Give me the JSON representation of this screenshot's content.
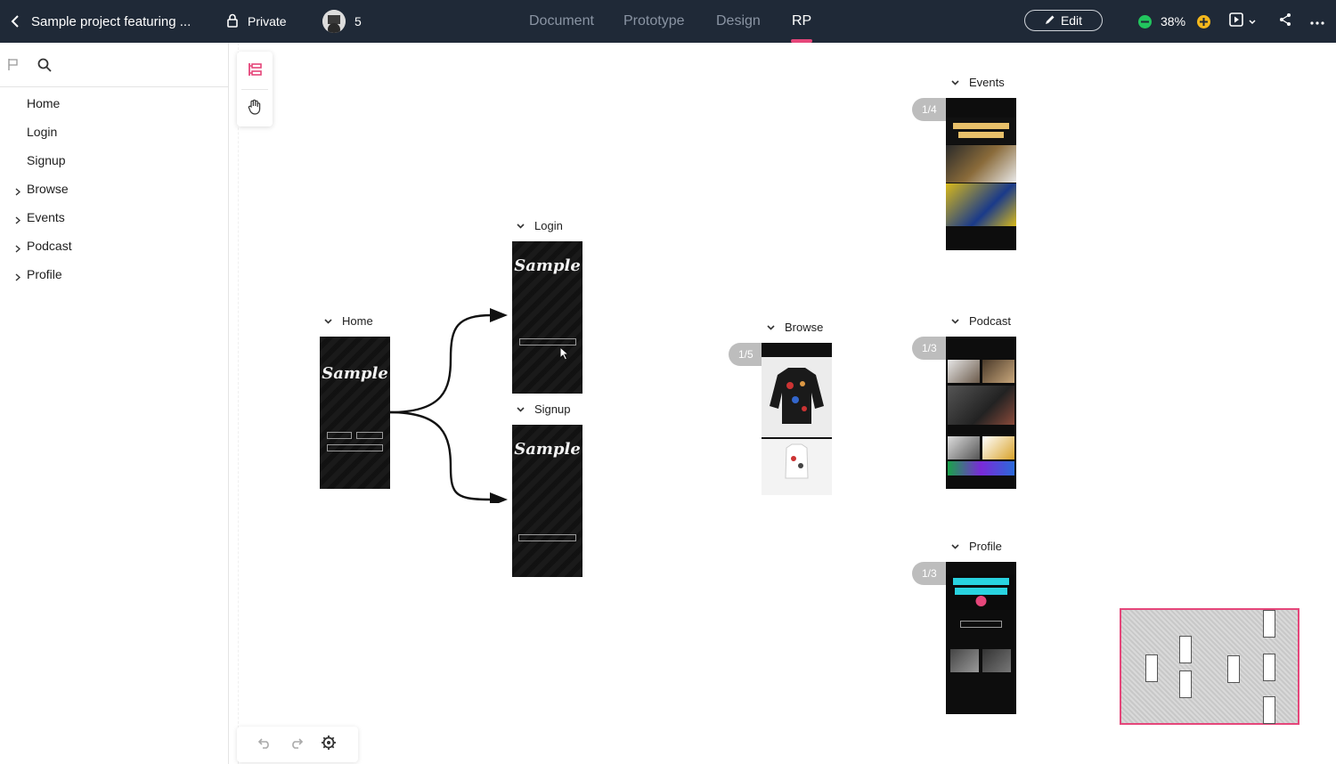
{
  "topbar": {
    "project_title": "Sample project featuring ...",
    "privacy": "Private",
    "collaborators": "5",
    "tabs": [
      "Document",
      "Prototype",
      "Design",
      "RP"
    ],
    "edit_label": "Edit",
    "zoom": "38%"
  },
  "sidebar": {
    "pages": [
      {
        "label": "Home",
        "expandable": false
      },
      {
        "label": "Login",
        "expandable": false
      },
      {
        "label": "Signup",
        "expandable": false
      },
      {
        "label": "Browse",
        "expandable": true
      },
      {
        "label": "Events",
        "expandable": true
      },
      {
        "label": "Podcast",
        "expandable": true
      },
      {
        "label": "Profile",
        "expandable": true
      }
    ]
  },
  "canvas": {
    "home": {
      "label": "Home",
      "logo": "Sample"
    },
    "login": {
      "label": "Login",
      "logo": "Sample"
    },
    "signup": {
      "label": "Signup",
      "logo": "Sample"
    },
    "browse": {
      "label": "Browse",
      "counter": "1/5"
    },
    "events": {
      "label": "Events",
      "counter": "1/4"
    },
    "podcast": {
      "label": "Podcast",
      "counter": "1/3"
    },
    "profile": {
      "label": "Profile",
      "counter": "1/3"
    }
  },
  "colors": {
    "topbar_bg": "#1f2937",
    "accent": "#e5467a",
    "zoom_out": "#22c55e",
    "zoom_in": "#f5b81c"
  }
}
